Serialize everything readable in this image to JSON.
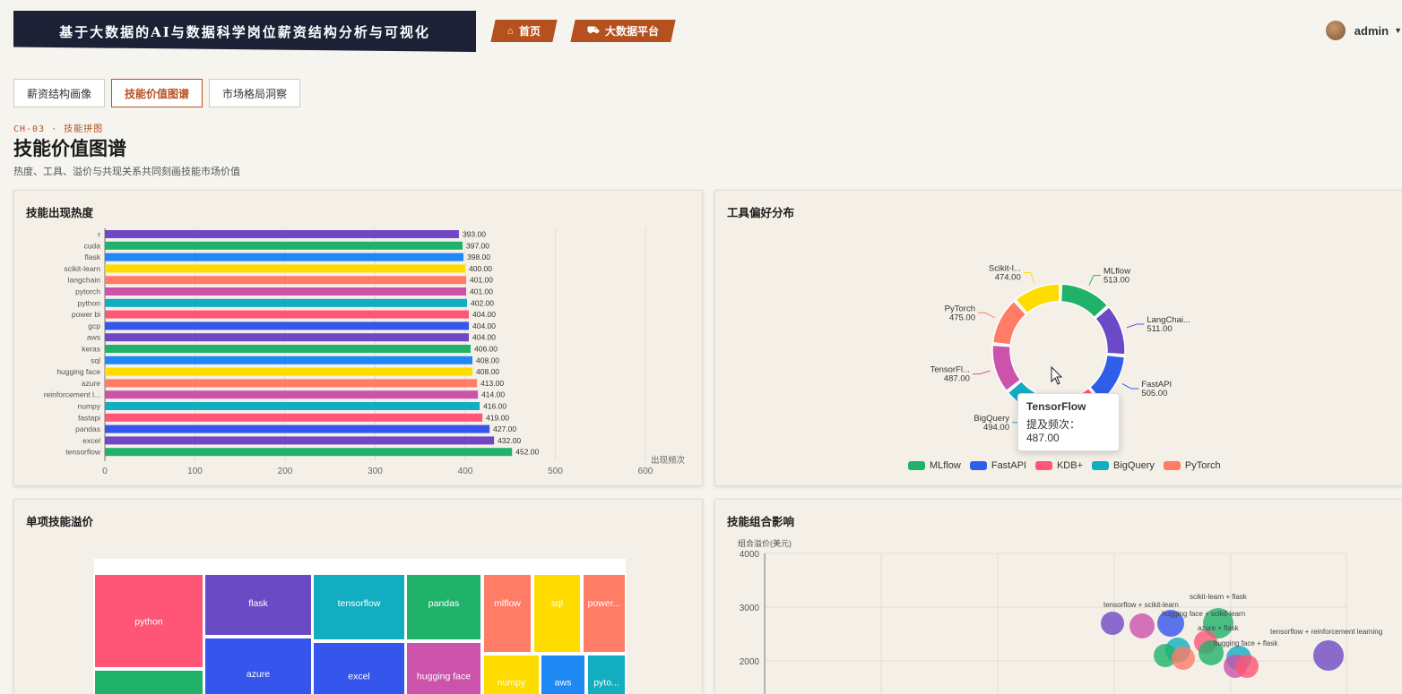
{
  "header": {
    "title": "基于大数据的AI与数据科学岗位薪资结构分析与可视化",
    "nav": [
      {
        "label": "首页",
        "icon": "home-icon"
      },
      {
        "label": "大数据平台",
        "icon": "cart-icon"
      }
    ],
    "user": {
      "name": "admin"
    }
  },
  "tabs": [
    {
      "label": "薪资结构画像",
      "active": false
    },
    {
      "label": "技能价值图谱",
      "active": true
    },
    {
      "label": "市场格局洞察",
      "active": false
    }
  ],
  "section": {
    "eyebrow": "CH-03 · 技能拼图",
    "title": "技能价值图谱",
    "subtitle": "热度、工具、溢价与共现关系共同刻画技能市场价值"
  },
  "panels": {
    "skill_heat": {
      "title": "技能出现热度"
    },
    "tool_pref": {
      "title": "工具偏好分布"
    },
    "single_premium": {
      "title": "单项技能溢价"
    },
    "combo_impact": {
      "title": "技能组合影响"
    }
  },
  "tooltip": {
    "title": "TensorFlow",
    "label": "提及频次：",
    "value": "487.00"
  },
  "colors": {
    "accent": "#b5501f",
    "banner": "#1d2136"
  },
  "chart_data": [
    {
      "id": "skill_heat",
      "type": "bar",
      "orientation": "horizontal",
      "categories": [
        "r",
        "cuda",
        "flask",
        "scikit-learn",
        "langchain",
        "pytorch",
        "python",
        "power bi",
        "gcp",
        "aws",
        "keras",
        "sql",
        "hugging face",
        "azure",
        "reinforcement l...",
        "numpy",
        "fastapi",
        "pandas",
        "excel",
        "tensorflow"
      ],
      "values": [
        393,
        397,
        398,
        400,
        401,
        401,
        402,
        404,
        404,
        404,
        406,
        408,
        408,
        413,
        414,
        416,
        419,
        427,
        432,
        452
      ],
      "value_labels": [
        "393.00",
        "397.00",
        "398.00",
        "400.00",
        "401.00",
        "401.00",
        "402.00",
        "404.00",
        "404.00",
        "404.00",
        "406.00",
        "408.00",
        "408.00",
        "413.00",
        "414.00",
        "416.00",
        "419.00",
        "427.00",
        "432.00",
        "452.00"
      ],
      "colors": [
        "#7048c6",
        "#21b26a",
        "#1e88f5",
        "#ffdc00",
        "#ff7c67",
        "#cb53aa",
        "#12adc0",
        "#ff5576",
        "#3555ec",
        "#7048c6",
        "#21b26a",
        "#1e88f5",
        "#ffdc00",
        "#ff7c67",
        "#cb53aa",
        "#12adc0",
        "#ff5576",
        "#3555ec",
        "#7048c6",
        "#21b26a"
      ],
      "xlabel": "出现频次",
      "xlim": [
        0,
        600
      ],
      "xticks": [
        "0",
        "100",
        "200",
        "300",
        "400",
        "500",
        "600"
      ],
      "grid": true
    },
    {
      "id": "tool_pref",
      "type": "pie",
      "donut": true,
      "slices": [
        {
          "name": "MLflow",
          "value": 513,
          "label": "MLflow",
          "label_value": "513.00",
          "color": "#21b26a"
        },
        {
          "name": "LangChain",
          "value": 511,
          "label": "LangChai...",
          "label_value": "511.00",
          "color": "#6b4bc5"
        },
        {
          "name": "FastAPI",
          "value": 505,
          "label": "FastAPI",
          "label_value": "505.00",
          "color": "#2f5ee8"
        },
        {
          "name": "KDB+",
          "value": 497,
          "label": "",
          "label_value": "",
          "color": "#ff5576"
        },
        {
          "name": "BigQuery",
          "value": 494,
          "label": "BigQuery",
          "label_value": "494.00",
          "color": "#12adc0"
        },
        {
          "name": "TensorFlow",
          "value": 487,
          "label": "TensorFl...",
          "label_value": "487.00",
          "color": "#cb53aa"
        },
        {
          "name": "PyTorch",
          "value": 475,
          "label": "PyTorch",
          "label_value": "475.00",
          "color": "#ff7c67"
        },
        {
          "name": "Scikit-learn",
          "value": 474,
          "label": "Scikit-l...",
          "label_value": "474.00",
          "color": "#ffdc00"
        }
      ],
      "legend": [
        "MLflow",
        "FastAPI",
        "KDB+",
        "BigQuery",
        "PyTorch"
      ],
      "legend_position": "bottom"
    },
    {
      "id": "single_premium",
      "type": "treemap",
      "cells": [
        {
          "name": "python",
          "color": "#ff5576"
        },
        {
          "name": "flask",
          "color": "#6b4bc5"
        },
        {
          "name": "tensorflow",
          "color": "#12adc0"
        },
        {
          "name": "pandas",
          "color": "#21b26a"
        },
        {
          "name": "mlflow",
          "color": "#ff7c67"
        },
        {
          "name": "sql",
          "color": "#ffdc00"
        },
        {
          "name": "power...",
          "color": "#ff7c67"
        },
        {
          "name": "azure",
          "color": "#3555ec"
        },
        {
          "name": "excel",
          "color": "#3555ec"
        },
        {
          "name": "hugging face",
          "color": "#cb53aa"
        },
        {
          "name": "numpy",
          "color": "#ffdc00"
        },
        {
          "name": "aws",
          "color": "#1e88f5"
        },
        {
          "name": "pyto...",
          "color": "#12adc0"
        },
        {
          "name": "",
          "color": "#21b26a"
        }
      ]
    },
    {
      "id": "combo_impact",
      "type": "scatter",
      "ylabel": "组合溢价(美元)",
      "yticks": [
        "4000",
        "3000",
        "2000"
      ],
      "ylim": [
        1300,
        4000
      ],
      "labels": [
        "tensorflow + scikit-learn",
        "scikit-learn + flask",
        "hugging face + scikit-learn",
        "azure + flask",
        "hugging face + flask",
        "tensorflow + reinforcement learning"
      ],
      "points": [
        {
          "x": 1,
          "y": 2700,
          "color": "#7048c6"
        },
        {
          "x": 2,
          "y": 2650,
          "color": "#cb53aa"
        },
        {
          "x": 3,
          "y": 2700,
          "color": "#3555ec"
        },
        {
          "x": 4,
          "y": 2700,
          "color": "#21b26a"
        },
        {
          "x": 5,
          "y": 2350,
          "color": "#ff5576"
        },
        {
          "x": 6,
          "y": 2200,
          "color": "#12adc0"
        },
        {
          "x": 7,
          "y": 2100,
          "color": "#21b26a"
        },
        {
          "x": 8,
          "y": 2050,
          "color": "#ff7c67"
        },
        {
          "x": 9,
          "y": 2150,
          "color": "#21b26a"
        },
        {
          "x": 10,
          "y": 2050,
          "color": "#12adc0"
        },
        {
          "x": 11,
          "y": 1900,
          "color": "#cb53aa"
        },
        {
          "x": 12,
          "y": 1900,
          "color": "#ff5576"
        },
        {
          "x": 13,
          "y": 2100,
          "color": "#7048c6"
        }
      ]
    }
  ]
}
